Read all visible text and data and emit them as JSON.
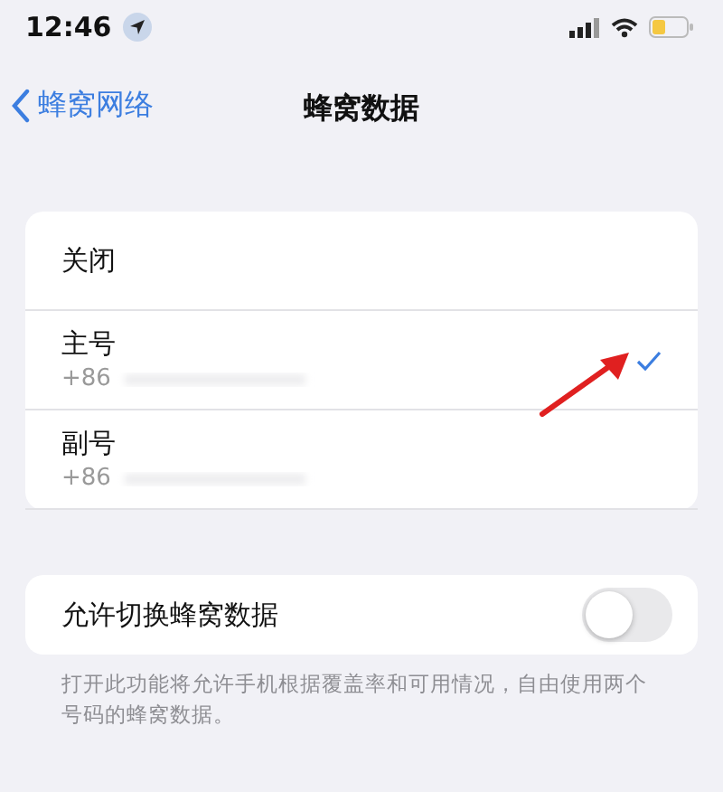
{
  "status_bar": {
    "time": "12:46"
  },
  "nav": {
    "back": "蜂窝网络",
    "title": "蜂窝数据"
  },
  "options": [
    {
      "label": "关闭",
      "selected": false
    },
    {
      "label": "主号",
      "number": "+86",
      "selected": true
    },
    {
      "label": "副号",
      "number": "+86",
      "selected": false
    }
  ],
  "switch_row": {
    "label": "允许切换蜂窝数据",
    "on": false
  },
  "footer": "打开此功能将允许手机根据覆盖率和可用情况，自由使用两个号码的蜂窝数据。"
}
